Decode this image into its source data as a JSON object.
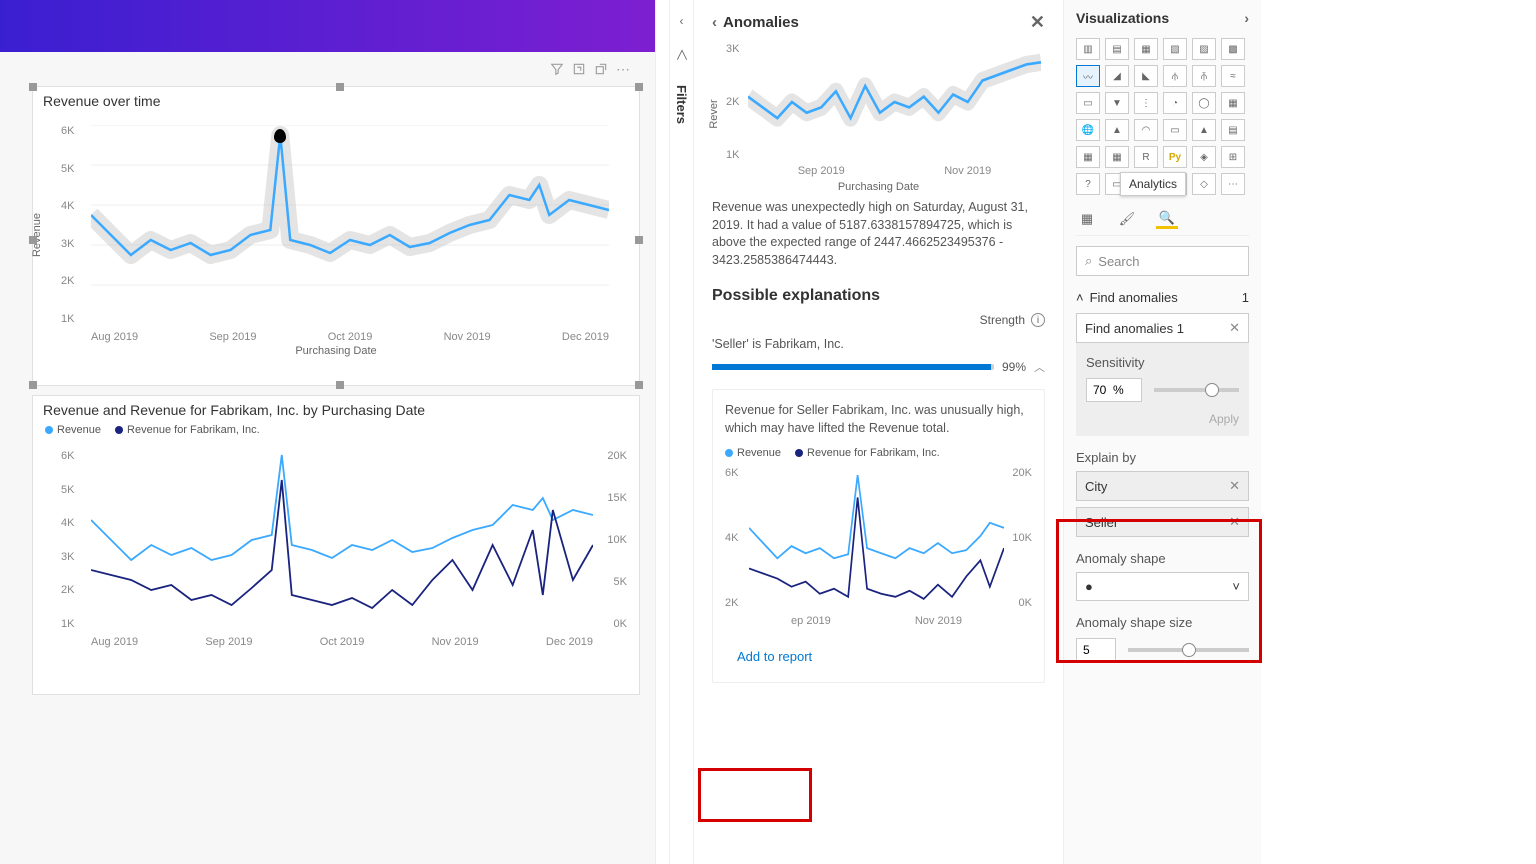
{
  "canvas": {
    "top_chart": {
      "title": "Revenue over time",
      "ylabel": "Revenue",
      "xlabel": "Purchasing Date",
      "yticks": [
        "6K",
        "5K",
        "4K",
        "3K",
        "2K",
        "1K"
      ],
      "xticks": [
        "Aug 2019",
        "Sep 2019",
        "Oct 2019",
        "Nov 2019",
        "Dec 2019"
      ]
    },
    "bottom_chart": {
      "title": "Revenue and Revenue for Fabrikam, Inc. by Purchasing Date",
      "legend1": "Revenue",
      "legend2": "Revenue for Fabrikam, Inc.",
      "yticks_left": [
        "6K",
        "5K",
        "4K",
        "3K",
        "2K",
        "1K"
      ],
      "yticks_right": [
        "20K",
        "15K",
        "10K",
        "5K",
        "0K"
      ],
      "xticks": [
        "Aug 2019",
        "Sep 2019",
        "Oct 2019",
        "Nov 2019",
        "Dec 2019"
      ]
    }
  },
  "filters_label": "Filters",
  "anomalies": {
    "title": "Anomalies",
    "mini_ylabel": "Rever",
    "mini_yticks": [
      "3K",
      "2K",
      "1K"
    ],
    "mini_xticks": [
      "Sep 2019",
      "Nov 2019"
    ],
    "mini_xlabel": "Purchasing Date",
    "description": "Revenue was unexpectedly high on Saturday, August 31, 2019. It had a value of 5187.6338157894725, which is above the expected range of 2447.4662523495376 - 3423.2585386474443.",
    "explanations_title": "Possible explanations",
    "strength_label": "Strength",
    "expl1_text": "'Seller' is Fabrikam, Inc.",
    "expl1_pct": "99%",
    "card_text": "Revenue for Seller Fabrikam, Inc. was unusually high, which may have lifted the Revenue total.",
    "card_legend1": "Revenue",
    "card_legend2": "Revenue for Fabrikam, Inc.",
    "card_yticks_left": [
      "6K",
      "4K",
      "2K"
    ],
    "card_yticks_right": [
      "20K",
      "10K",
      "0K"
    ],
    "card_xticks": [
      "ep 2019",
      "Nov 2019"
    ],
    "add_to_report": "Add to report"
  },
  "viz": {
    "title": "Visualizations",
    "tooltip": "Analytics",
    "search": "Search",
    "find_anomalies": "Find anomalies",
    "find_count": "1",
    "find_name": "Find anomalies 1",
    "sensitivity_label": "Sensitivity",
    "sensitivity_value": "70  %",
    "apply": "Apply",
    "explain_by": "Explain by",
    "explain_field1": "City",
    "explain_field2": "Seller",
    "shape_label": "Anomaly shape",
    "shape_size_label": "Anomaly shape size",
    "shape_size_value": "5"
  },
  "chart_data": [
    {
      "type": "line",
      "title": "Revenue over time",
      "xlabel": "Purchasing Date",
      "ylabel": "Revenue",
      "ylim": [
        1000,
        6000
      ],
      "x_categories": [
        "Aug 2019",
        "Sep 2019",
        "Oct 2019",
        "Nov 2019",
        "Dec 2019"
      ],
      "series": [
        {
          "name": "Revenue",
          "values_approx": [
            2800,
            2500,
            2300,
            2700,
            2400,
            2900,
            5500,
            2600,
            2700,
            2500,
            2800,
            2600,
            2700,
            2500,
            2900,
            3000,
            3100,
            3300,
            3600,
            3800,
            3500,
            3400
          ]
        },
        {
          "name": "Expected range band",
          "note": "gray confidence band around line"
        }
      ],
      "anomaly_point": {
        "x": "Aug 31 2019",
        "value": 5187.63
      }
    },
    {
      "type": "line",
      "title": "Revenue and Revenue for Fabrikam, Inc. by Purchasing Date",
      "xlabel": "Purchasing Date",
      "y_left": {
        "label": "Revenue",
        "lim": [
          1000,
          6000
        ]
      },
      "y_right": {
        "label": "Revenue for Fabrikam",
        "lim": [
          0,
          20000
        ]
      },
      "series": [
        {
          "name": "Revenue",
          "axis": "left",
          "color": "#3aa9ff"
        },
        {
          "name": "Revenue for Fabrikam, Inc.",
          "axis": "right",
          "color": "#1a237e"
        }
      ]
    },
    {
      "type": "line",
      "title": "Anomalies mini chart",
      "xlabel": "Purchasing Date",
      "ylabel": "Rever",
      "ylim": [
        1000,
        3500
      ],
      "series": [
        {
          "name": "Revenue",
          "note": "with gray expected band"
        }
      ]
    }
  ]
}
